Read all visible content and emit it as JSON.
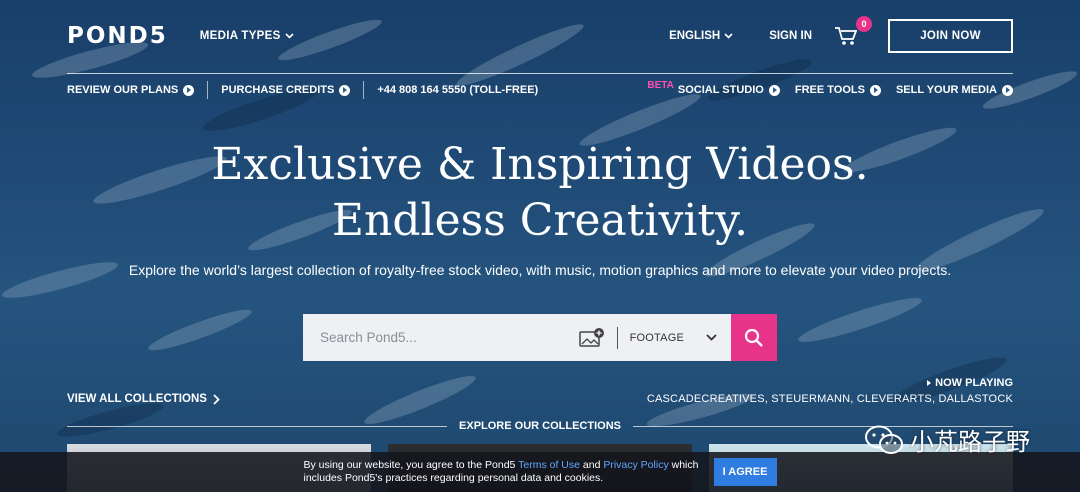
{
  "header": {
    "logo": "POND5",
    "media_types": "MEDIA TYPES",
    "language": "ENGLISH",
    "sign_in": "SIGN IN",
    "cart_count": "0",
    "join": "JOIN NOW"
  },
  "subnav": {
    "review_plans": "REVIEW OUR PLANS",
    "purchase_credits": "PURCHASE CREDITS",
    "phone": "+44 808 164 5550 (TOLL-FREE)",
    "beta": "BETA",
    "social_studio": "SOCIAL STUDIO",
    "free_tools": "FREE TOOLS",
    "sell_media": "SELL YOUR MEDIA"
  },
  "hero": {
    "headline_1": "Exclusive & Inspiring Videos.",
    "headline_2": "Endless Creativity.",
    "tagline": "Explore the world’s largest collection of royalty-free stock video, with music, motion graphics and more to elevate your video projects."
  },
  "search": {
    "placeholder": "Search Pond5...",
    "media_filter": "FOOTAGE"
  },
  "collections": {
    "view_all": "VIEW ALL COLLECTIONS",
    "now_playing_label": "NOW PLAYING",
    "now_playing_names": "CASCADECREATIVES, STEUERMANN, CLEVERARTS, DALLASTOCK",
    "explore": "EXPLORE OUR COLLECTIONS"
  },
  "cookie": {
    "text_1": "By using our website, you agree to the Pond5 ",
    "terms": "Terms of Use",
    "text_2": " and ",
    "privacy": "Privacy Policy",
    "text_3": " which includes Pond5's practices regarding personal data and cookies.",
    "agree": "I AGREE"
  },
  "watermark": {
    "text": "小芃路子野"
  },
  "colors": {
    "accent_pink": "#e8338a",
    "agree_blue": "#2f7de1",
    "link_blue": "#5fa8ff"
  }
}
